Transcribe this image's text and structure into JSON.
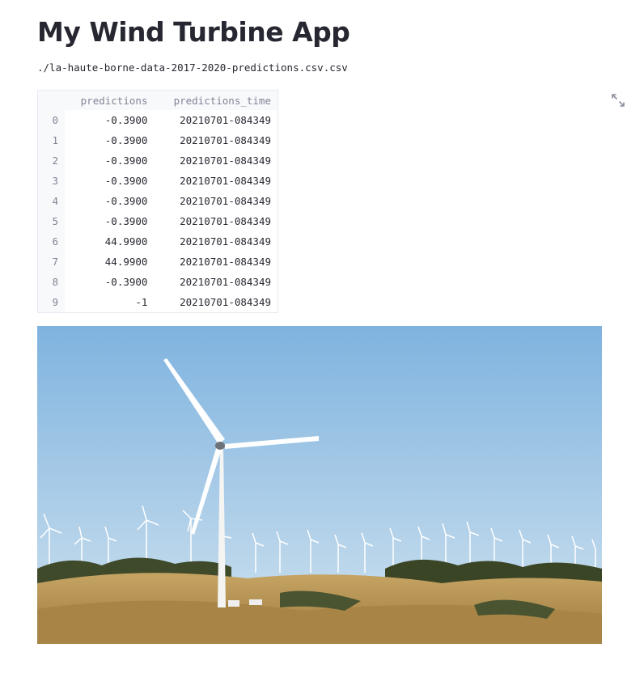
{
  "header": {
    "title": "My Wind Turbine App"
  },
  "file": {
    "path": "./la-haute-borne-data-2017-2020-predictions.csv.csv"
  },
  "table": {
    "columns": [
      "predictions",
      "predictions_time"
    ],
    "rows": [
      {
        "index": "0",
        "predictions": "-0.3900",
        "predictions_time": "20210701-084349"
      },
      {
        "index": "1",
        "predictions": "-0.3900",
        "predictions_time": "20210701-084349"
      },
      {
        "index": "2",
        "predictions": "-0.3900",
        "predictions_time": "20210701-084349"
      },
      {
        "index": "3",
        "predictions": "-0.3900",
        "predictions_time": "20210701-084349"
      },
      {
        "index": "4",
        "predictions": "-0.3900",
        "predictions_time": "20210701-084349"
      },
      {
        "index": "5",
        "predictions": "-0.3900",
        "predictions_time": "20210701-084349"
      },
      {
        "index": "6",
        "predictions": "44.9900",
        "predictions_time": "20210701-084349"
      },
      {
        "index": "7",
        "predictions": "44.9900",
        "predictions_time": "20210701-084349"
      },
      {
        "index": "8",
        "predictions": "-0.3900",
        "predictions_time": "20210701-084349"
      },
      {
        "index": "9",
        "predictions": "-1",
        "predictions_time": "20210701-084349"
      }
    ]
  },
  "controls": {
    "fullscreen_icon": "expand-icon"
  },
  "image": {
    "subject": "wind-farm-photo"
  },
  "colors": {
    "text": "#262730",
    "muted": "#808495",
    "header_bg": "#f8f9fb",
    "sky_top": "#7fb3df",
    "sky_bottom": "#cfe2ef",
    "hill": "#b7924f"
  }
}
